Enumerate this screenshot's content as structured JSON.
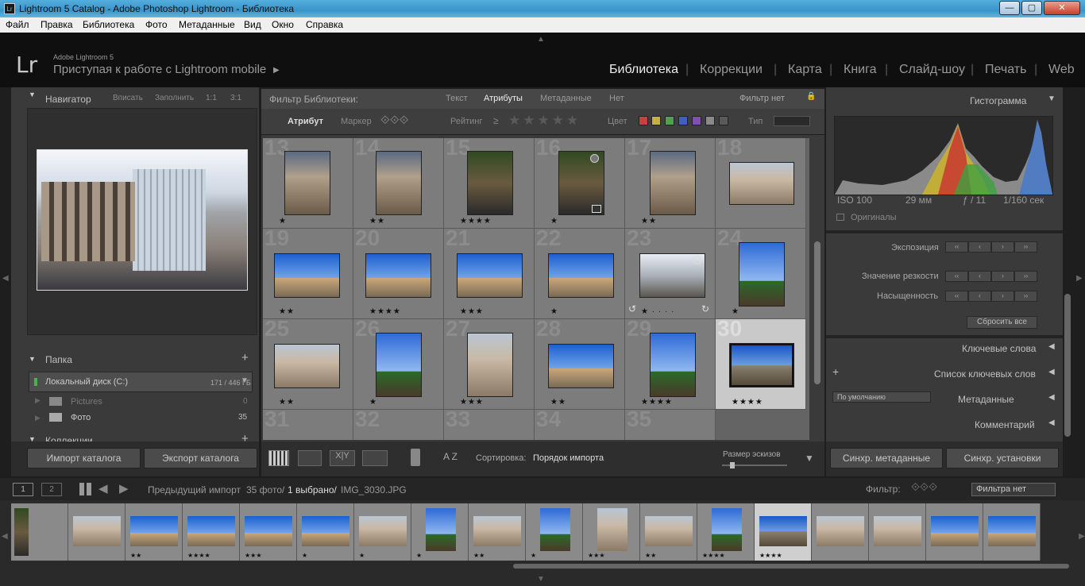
{
  "window": {
    "title": "Lightroom 5 Catalog - Adobe Photoshop Lightroom - Библиотека",
    "icon": "Lr",
    "min": "—",
    "max": "▢",
    "close": "✕"
  },
  "menu": [
    "Файл",
    "Правка",
    "Библиотека",
    "Фото",
    "Метаданные",
    "Вид",
    "Окно",
    "Справка"
  ],
  "identity": {
    "logo": "Lr",
    "line1": "Adobe Lightroom 5",
    "line2": "Приступая к работе с Lightroom mobile",
    "arrow": "▶"
  },
  "modules": [
    "Библиотека",
    "Коррекции",
    "Карта",
    "Книга",
    "Слайд-шоу",
    "Печать",
    "Web"
  ],
  "navigator": {
    "title": "Навигатор",
    "opts": [
      "Вписать",
      "Заполнить",
      "1:1",
      "3:1"
    ]
  },
  "folders": {
    "title": "Папка",
    "add": "+",
    "disk": "Локальный диск (C:)",
    "disk_size": "171 / 446 ГБ",
    "items": [
      {
        "name": "Pictures",
        "count": "0"
      },
      {
        "name": "Фото",
        "count": "35"
      }
    ]
  },
  "collections": {
    "title": "Коллекции",
    "add": "+"
  },
  "left_buttons": {
    "import": "Импорт каталога",
    "export": "Экспорт каталога"
  },
  "filter": {
    "title": "Фильтр Библиотеки:",
    "tabs": [
      "Текст",
      "Атрибуты",
      "Метаданные",
      "Нет"
    ],
    "preset": "Фильтр нет",
    "attr": "Атрибут",
    "marker": "Маркер",
    "rating": "Рейтинг",
    "ge": "≥",
    "color": "Цвет",
    "type": "Тип",
    "lock": "🔒"
  },
  "colors": {
    "red": "#c84040",
    "yellow": "#c8b040",
    "green": "#50a050",
    "blue": "#4060c0",
    "purple": "#8050b0",
    "gray": "#8a8a8a",
    "none": "#5a5a5a",
    "accent": "#eeeeee"
  },
  "grid": {
    "rows": [
      [
        {
          "n": "13",
          "s": "★"
        },
        {
          "n": "14",
          "s": "★★"
        },
        {
          "n": "15",
          "s": "★★★★"
        },
        {
          "n": "16",
          "s": "★"
        },
        {
          "n": "17",
          "s": "★★"
        },
        {
          "n": "18",
          "s": ""
        }
      ],
      [
        {
          "n": "19",
          "s": "★★"
        },
        {
          "n": "20",
          "s": "★★★★"
        },
        {
          "n": "21",
          "s": "★★★"
        },
        {
          "n": "22",
          "s": "★"
        },
        {
          "n": "23",
          "s": "★ · · · ·"
        },
        {
          "n": "24",
          "s": "★"
        }
      ],
      [
        {
          "n": "25",
          "s": "★★"
        },
        {
          "n": "26",
          "s": "★"
        },
        {
          "n": "27",
          "s": "★★★"
        },
        {
          "n": "28",
          "s": "★★"
        },
        {
          "n": "29",
          "s": "★★★★"
        },
        {
          "n": "30",
          "s": "★★★★"
        }
      ],
      [
        {
          "n": "31",
          "s": ""
        },
        {
          "n": "32",
          "s": ""
        },
        {
          "n": "33",
          "s": ""
        },
        {
          "n": "34",
          "s": ""
        },
        {
          "n": "35",
          "s": ""
        }
      ]
    ]
  },
  "toolbar": {
    "sort_label": "Сортировка:",
    "sort_value": "Порядок импорта",
    "thumb_size": "Размер эскизов",
    "az": "A Z"
  },
  "histogram": {
    "title": "Гистограмма",
    "iso": "ISO 100",
    "focal": "29 мм",
    "aperture": "ƒ / 11",
    "shutter": "1/160 сек",
    "originals": "Оригиналы"
  },
  "quick_develop": {
    "exposure": "Экспозиция",
    "sharpness": "Значение резкости",
    "saturation": "Насыщенность",
    "reset": "Сбросить все"
  },
  "right_sections": {
    "keywording": "Ключевые слова",
    "keyword_list": "Список ключевых слов",
    "plus": "+",
    "metadata": "Метаданные",
    "metadata_preset": "По умолчанию",
    "comments": "Комментарий"
  },
  "right_buttons": {
    "sync_meta": "Синхр. метаданные",
    "sync_settings": "Синхр. установки"
  },
  "filmstrip": {
    "view1": "1",
    "view2": "2",
    "source": "Предыдущий импорт",
    "count": "35 фото/",
    "selected": "1 выбрано/",
    "file": "IMG_3030.JPG",
    "filter_label": "Фильтр:",
    "filter_value": "Фильтра нет",
    "stars": [
      "",
      "",
      "★★",
      "★★★★",
      "★★★",
      "★",
      "★",
      "★",
      "★★",
      "★",
      "★★★",
      "★★",
      "★★★★",
      "★★★★",
      "",
      "",
      "",
      "",
      ""
    ]
  }
}
